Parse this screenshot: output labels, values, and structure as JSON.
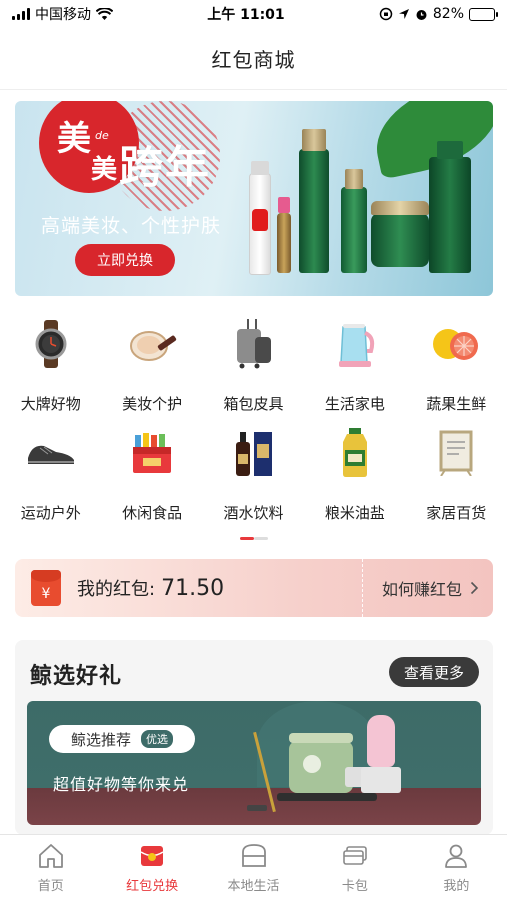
{
  "status_bar": {
    "carrier": "中国移动",
    "time": "上午 11:01",
    "battery": "82%",
    "battery_level": 0.82
  },
  "header": {
    "title": "红包商城"
  },
  "banner": {
    "big_text_1": "美",
    "de": "de",
    "big_text_2": "美",
    "headline_1": "跨",
    "headline_2": "年",
    "subtitle": "高端美妆、个性护肤",
    "cta_label": "立即兑换"
  },
  "categories": [
    {
      "label": "大牌好物",
      "icon": "watch-icon"
    },
    {
      "label": "美妆个护",
      "icon": "cosmetics-icon"
    },
    {
      "label": "箱包皮具",
      "icon": "luggage-icon"
    },
    {
      "label": "生活家电",
      "icon": "kettle-icon"
    },
    {
      "label": "蔬果生鲜",
      "icon": "grapefruit-icon"
    },
    {
      "label": "运动户外",
      "icon": "shoe-icon"
    },
    {
      "label": "休闲食品",
      "icon": "snacks-icon"
    },
    {
      "label": "酒水饮料",
      "icon": "liquor-icon"
    },
    {
      "label": "粮米油盐",
      "icon": "oil-bottle-icon"
    },
    {
      "label": "家居百货",
      "icon": "photo-frame-icon"
    }
  ],
  "red_packet": {
    "icon_symbol": "¥",
    "label": "我的红包:",
    "amount": "71.50",
    "earn_label": "如何赚红包"
  },
  "featured": {
    "title": "鲸选好礼",
    "more_label": "查看更多",
    "promo_pill": "鲸选推荐",
    "promo_tag": "优选",
    "promo_text": "超值好物等你来兑"
  },
  "tab_bar": [
    {
      "label": "首页",
      "icon": "home-icon",
      "active": false
    },
    {
      "label": "红包兑换",
      "icon": "red-packet-icon",
      "active": true
    },
    {
      "label": "本地生活",
      "icon": "local-life-icon",
      "active": false
    },
    {
      "label": "卡包",
      "icon": "card-wallet-icon",
      "active": false
    },
    {
      "label": "我的",
      "icon": "profile-icon",
      "active": false
    }
  ],
  "colors": {
    "accent": "#e8393c",
    "banner_red": "#d8262c",
    "tab_inactive": "#8a8a8a"
  }
}
